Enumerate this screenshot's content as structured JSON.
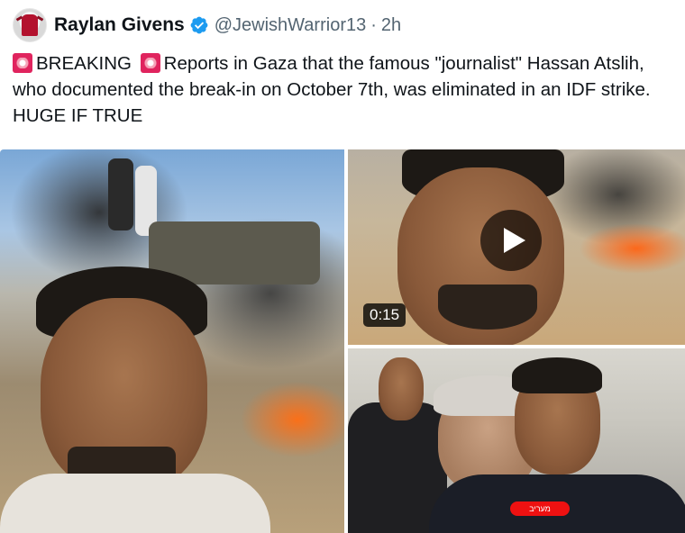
{
  "author": {
    "name": "Raylan Givens",
    "handle": "@JewishWarrior13",
    "separator": "·",
    "time": "2h",
    "verified_color": "#1d9bf0"
  },
  "tweet": {
    "text_1": "BREAKING",
    "text_2": "Reports in Gaza that the famous \"journalist\" Hassan Atslih, who documented the break-in on October 7th, was eliminated in an IDF strike. HUGE IF TRUE",
    "siren_icon": "police-car-light-emoji"
  },
  "media": {
    "video_duration": "0:15",
    "channel_badge_text": "מעריב"
  }
}
